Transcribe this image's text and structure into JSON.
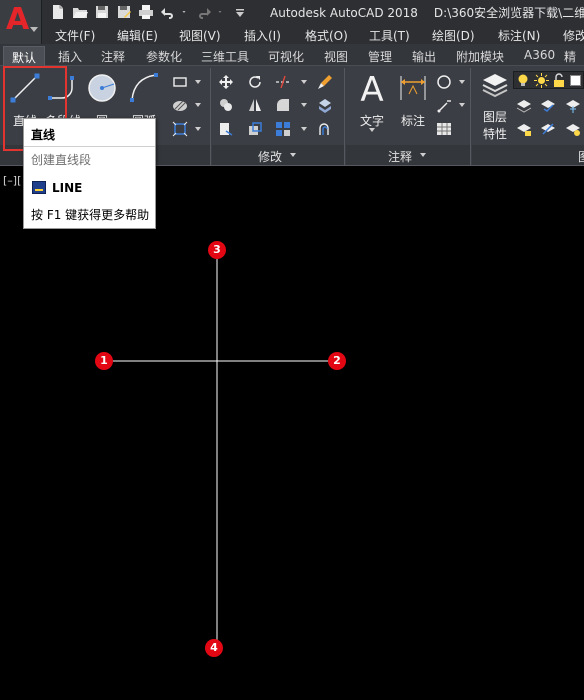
{
  "titlebar": {
    "app": "Autodesk AutoCAD 2018",
    "path": "D:\\360安全浏览器下载\\二维"
  },
  "menus": [
    "文件(F)",
    "编辑(E)",
    "视图(V)",
    "插入(I)",
    "格式(O)",
    "工具(T)",
    "绘图(D)",
    "标注(N)",
    "修改"
  ],
  "tabs": [
    "默认",
    "插入",
    "注释",
    "参数化",
    "三维工具",
    "可视化",
    "视图",
    "管理",
    "输出",
    "附加模块",
    "A360",
    "精"
  ],
  "draw_panel": {
    "line": "直线",
    "polyline": "多段线",
    "circle": "圆",
    "arc": "圆弧"
  },
  "panels": {
    "modify": "修改",
    "annotate": "注释",
    "right_edge": "图"
  },
  "annotation": {
    "text": "文字",
    "dimension": "标注"
  },
  "layers": {
    "props_line1": "图层",
    "props_line2": "特性"
  },
  "tooltip": {
    "title": "直线",
    "desc": "创建直线段",
    "command": "LINE",
    "help": "按 F1 键获得更多帮助"
  },
  "viewport": {
    "label": "[–][",
    "markers": [
      "1",
      "2",
      "3",
      "4"
    ]
  },
  "colors": {
    "accent": "#e4262b",
    "marker": "#e30613",
    "highlight": "#e3342f"
  }
}
